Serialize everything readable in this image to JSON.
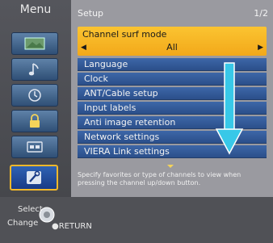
{
  "menu": {
    "title": "Menu",
    "items": [
      {
        "icon": "picture-icon"
      },
      {
        "icon": "sound-icon"
      },
      {
        "icon": "timer-icon"
      },
      {
        "icon": "lock-icon"
      },
      {
        "icon": "setup-card-icon"
      },
      {
        "icon": "setup-tools-icon",
        "selected": true
      }
    ]
  },
  "setup": {
    "title": "Setup",
    "page": "1/2",
    "selected_setting": {
      "label": "Channel surf mode",
      "value": "All"
    },
    "items": [
      "Language",
      "Clock",
      "ANT/Cable setup",
      "Input labels",
      "Anti image retention",
      "Network settings",
      "VIERA Link settings"
    ],
    "hint": "Specify favorites or type of channels to view when pressing the channel up/down button."
  },
  "footer": {
    "select_label": "Select",
    "change_label": "Change",
    "return_label": "RETURN"
  },
  "colors": {
    "highlight": "#f2a81a",
    "item_blue": "#2b4f8a",
    "arrow_cyan": "#38c8e8"
  }
}
